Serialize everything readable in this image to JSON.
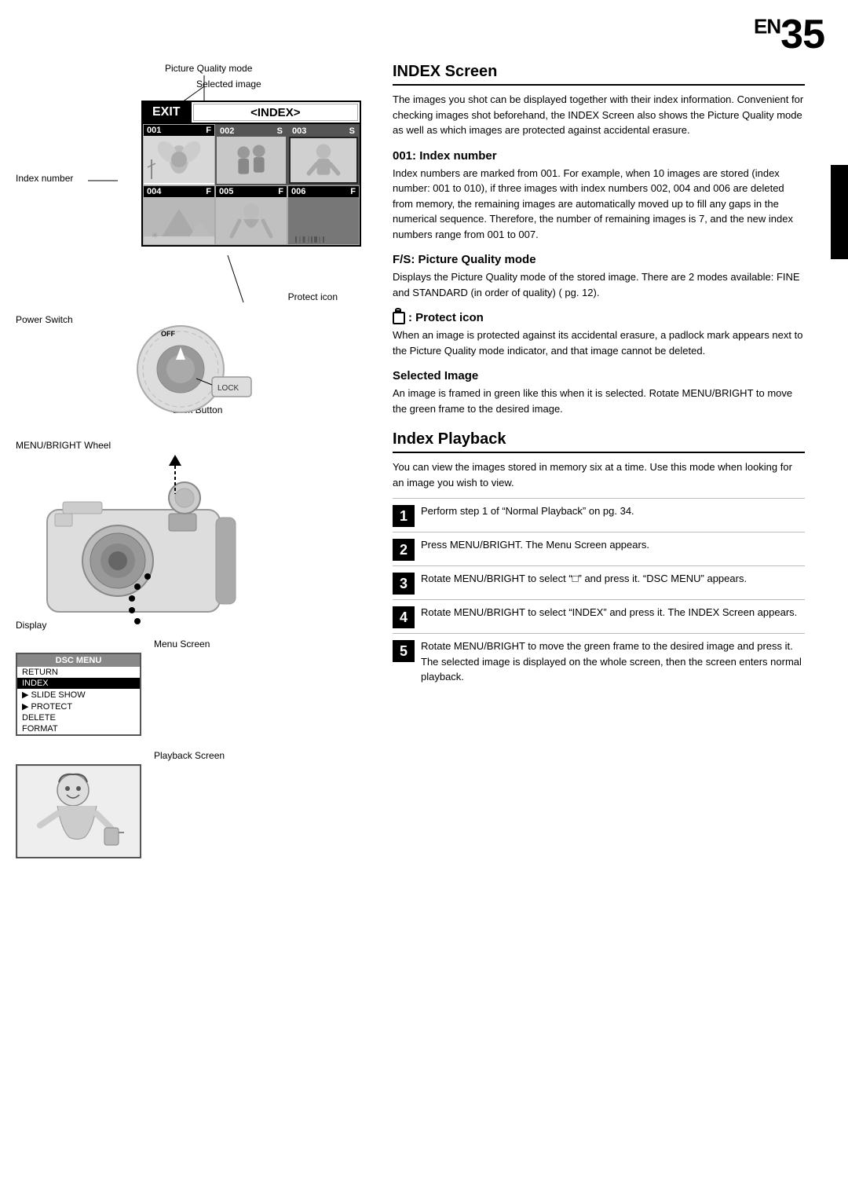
{
  "page": {
    "number": "35",
    "prefix": "EN"
  },
  "right_panel": {
    "main_title": "INDEX Screen",
    "intro_text": "The images you shot can be displayed together with their index information. Convenient for checking images shot beforehand, the INDEX Screen also shows the Picture Quality mode as well as which images are protected against accidental erasure.",
    "sections": [
      {
        "id": "index-number",
        "title": "001: Index number",
        "text": "Index numbers are marked from 001. For example, when 10 images are stored (index number: 001 to 010), if three images with index numbers 002, 004 and 006 are deleted from memory, the remaining images are automatically moved up to fill any gaps in the numerical sequence. Therefore, the number of remaining images is 7, and the new index numbers range from 001 to 007."
      },
      {
        "id": "picture-quality",
        "title": "F/S: Picture Quality mode",
        "text": "Displays the Picture Quality mode of the stored image. There are 2 modes available: FINE and STANDARD (in order of quality) (    pg. 12)."
      },
      {
        "id": "protect-icon",
        "title": "🔒 : Protect icon",
        "title_text": ": Protect icon",
        "text": "When an image is protected against its accidental erasure, a padlock mark appears next to the Picture Quality mode indicator, and that image cannot be deleted."
      },
      {
        "id": "selected-image",
        "title": "Selected Image",
        "text": "An image is framed in green like this when it is selected. Rotate MENU/BRIGHT to move the green frame to the desired image."
      }
    ],
    "index_playback_title": "Index Playback",
    "index_playback_intro": "You can view the images stored in memory six at a time. Use this mode when looking for an image you wish to view.",
    "steps": [
      {
        "number": "1",
        "text": "Perform step 1 of “Normal Playback” on pg. 34."
      },
      {
        "number": "2",
        "text": "Press MENU/BRIGHT. The Menu Screen appears."
      },
      {
        "number": "3",
        "text": "Rotate MENU/BRIGHT to select “□” and press it. “DSC MENU” appears."
      },
      {
        "number": "4",
        "text": "Rotate MENU/BRIGHT to select “INDEX” and press it. The INDEX Screen appears."
      },
      {
        "number": "5",
        "text": "Rotate MENU/BRIGHT to move the green frame to the desired image and press it. The selected image is displayed on the whole screen, then the screen enters normal playback."
      }
    ]
  },
  "left_panel": {
    "annotations": {
      "picture_quality_mode": "Picture Quality mode",
      "index_number": "Index number",
      "selected_image": "Selected image",
      "protect_icon": "Protect icon",
      "power_switch": "Power Switch",
      "lock_button": "Lock Button",
      "menu_bright_wheel": "MENU/BRIGHT Wheel",
      "display": "Display",
      "menu_screen": "Menu Screen",
      "playback_screen": "Playback Screen"
    },
    "index_screen": {
      "exit_label": "EXIT",
      "index_label": "<INDEX>",
      "cells": [
        {
          "num": "001",
          "quality": "F",
          "selected": false
        },
        {
          "num": "002",
          "quality": "S",
          "selected": true
        },
        {
          "num": "003",
          "quality": "S",
          "selected": true
        },
        {
          "num": "004",
          "quality": "F",
          "selected": false
        },
        {
          "num": "005",
          "quality": "F",
          "selected": false
        },
        {
          "num": "006",
          "quality": "F",
          "selected": false
        }
      ]
    },
    "menu_screen": {
      "header": "DSC MENU",
      "items": [
        {
          "label": "RETURN",
          "highlighted": false
        },
        {
          "label": "INDEX",
          "highlighted": true
        },
        {
          "label": "SLIDE SHOW",
          "highlighted": false,
          "icon": true
        },
        {
          "label": "PROTECT",
          "highlighted": false,
          "icon": true
        },
        {
          "label": "DELETE",
          "highlighted": false
        },
        {
          "label": "FORMAT",
          "highlighted": false
        }
      ]
    }
  }
}
